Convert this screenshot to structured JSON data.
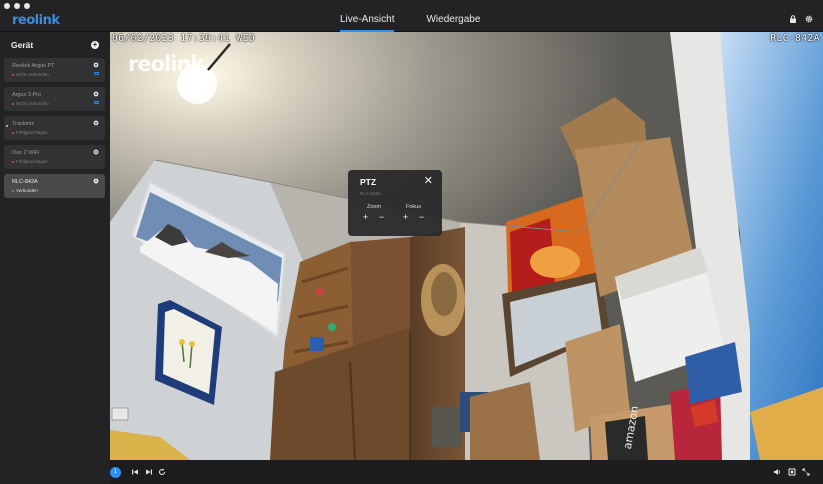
{
  "app": {
    "logo": "reolink",
    "window_controls": [
      "close",
      "minimize",
      "zoom"
    ]
  },
  "tabs": [
    {
      "label": "Live-Ansicht",
      "active": true
    },
    {
      "label": "Wiedergabe",
      "active": false
    }
  ],
  "top_icons": [
    "lock-icon",
    "gear-icon"
  ],
  "sidebar": {
    "title": "Gerät",
    "add_icon": "plus-icon",
    "devices": [
      {
        "name": "Reolink Argus PT",
        "status": "Nicht verbunden",
        "status_color": "#d9534f",
        "battery": true,
        "active": false
      },
      {
        "name": "Argus 3 Pro",
        "status": "Nicht verbunden",
        "status_color": "#d9534f",
        "battery": true,
        "active": false
      },
      {
        "name": "Trackmix",
        "status": "Fehlgeschlagen",
        "status_color": "#d9534f",
        "battery": false,
        "active": false
      },
      {
        "name": "Duo 2 WiFi",
        "status": "Fehlgeschlagen",
        "status_color": "#d9534f",
        "battery": false,
        "active": false
      },
      {
        "name": "RLC-842A",
        "status": "Verbunden",
        "status_color": "#3fbf5a",
        "battery": false,
        "active": true
      }
    ]
  },
  "video": {
    "timestamp_osd": "06/02/2023 17:39:41 WED",
    "camera_name_osd": "RLC-842A",
    "watermark": "reolink"
  },
  "ptz": {
    "title": "PTZ",
    "subtitle": "RLC-842A",
    "zoom_label": "Zoom",
    "focus_label": "Fokus",
    "plus": "+",
    "minus": "−",
    "close": "✕"
  },
  "bottom_bar": {
    "channel": "1",
    "left_icons": [
      "skip-back-icon",
      "skip-forward-icon",
      "refresh-icon"
    ],
    "right_icons": [
      "speaker-icon",
      "screenshot-icon",
      "fullscreen-icon"
    ]
  },
  "colors": {
    "accent": "#2f8ff0",
    "sidebar_bg": "#232325",
    "active_device_bg": "#4a4a4d"
  }
}
